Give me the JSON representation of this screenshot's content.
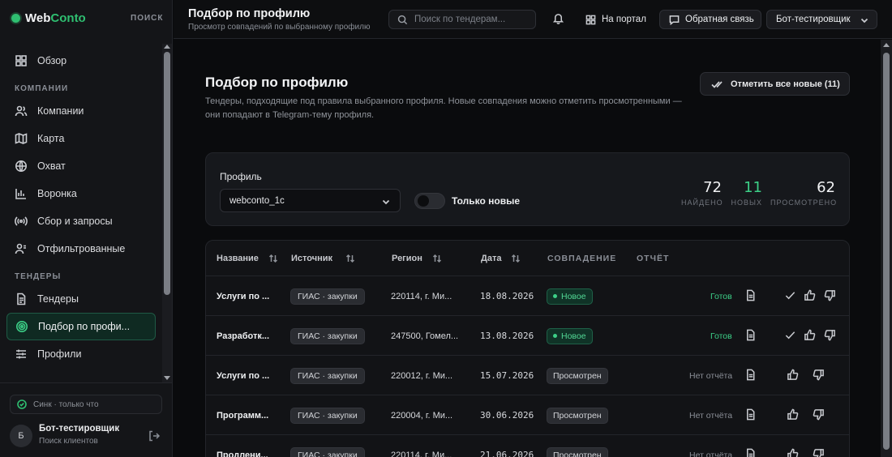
{
  "app": {
    "brand_part1": "Web",
    "brand_part2": "Conto",
    "search_label": "ПОИСК",
    "accent": "#2fbf71"
  },
  "sidebar": {
    "overview": "Обзор",
    "section_companies": "КОМПАНИИ",
    "companies": "Компании",
    "map": "Карта",
    "coverage": "Охват",
    "funnel": "Воронка",
    "collection": "Сбор и запросы",
    "filtered": "Отфильтрованные",
    "section_tenders": "ТЕНДЕРЫ",
    "tenders": "Тендеры",
    "profile_match": "Подбор по профи...",
    "profiles": "Профили",
    "sync": "Синк · только что",
    "avatar_letter": "Б",
    "user_name": "Бот-тестировщик",
    "user_sub": "Поиск клиентов"
  },
  "header": {
    "title": "Подбор по профилю",
    "subtitle": "Просмотр совпадений по выбранному профилю",
    "search_placeholder": "Поиск по тендерам...",
    "portal": "На портал",
    "feedback": "Обратная связь",
    "user_select": "Бот-тестировщик"
  },
  "page": {
    "title": "Подбор по профилю",
    "description": "Тендеры, подходящие под правила выбранного профиля. Новые совпадения можно отметить просмотренными — они попадают в Telegram-тему профиля.",
    "mark_all": "Отметить все новые (11)"
  },
  "filter": {
    "profile_label": "Профиль",
    "profile_value": "webconto_1c",
    "only_new_label": "Только новые",
    "only_new_on": false,
    "stats": [
      {
        "num": "72",
        "cap": "НАЙДЕНО"
      },
      {
        "num": "11",
        "cap": "НОВЫХ"
      },
      {
        "num": "62",
        "cap": "ПРОСМОТРЕНО"
      }
    ]
  },
  "table": {
    "headers": {
      "name": "Название",
      "source": "Источник",
      "region": "Регион",
      "date": "Дата",
      "match": "СОВПАДЕНИЕ",
      "report": "ОТЧЁТ"
    },
    "rows": [
      {
        "name": "Услуги по ...",
        "source": "ГИАС · закупки",
        "region": "220114, г. Ми...",
        "date": "18.08.2026",
        "status": "Новое",
        "report": "Готов"
      },
      {
        "name": "Разработк...",
        "source": "ГИАС · закупки",
        "region": "247500, Гомел...",
        "date": "13.08.2026",
        "status": "Новое",
        "report": "Готов"
      },
      {
        "name": "Услуги по ...",
        "source": "ГИАС · закупки",
        "region": "220012, г. Ми...",
        "date": "15.07.2026",
        "status": "Просмотрен",
        "report": "Нет отчёта"
      },
      {
        "name": "Программ...",
        "source": "ГИАС · закупки",
        "region": "220004, г. Ми...",
        "date": "30.06.2026",
        "status": "Просмотрен",
        "report": "Нет отчёта"
      },
      {
        "name": "Продлени...",
        "source": "ГИАС · закупки",
        "region": "220114, г. Ми...",
        "date": "21.06.2026",
        "status": "Просмотрен",
        "report": "Нет отчёта"
      }
    ]
  }
}
